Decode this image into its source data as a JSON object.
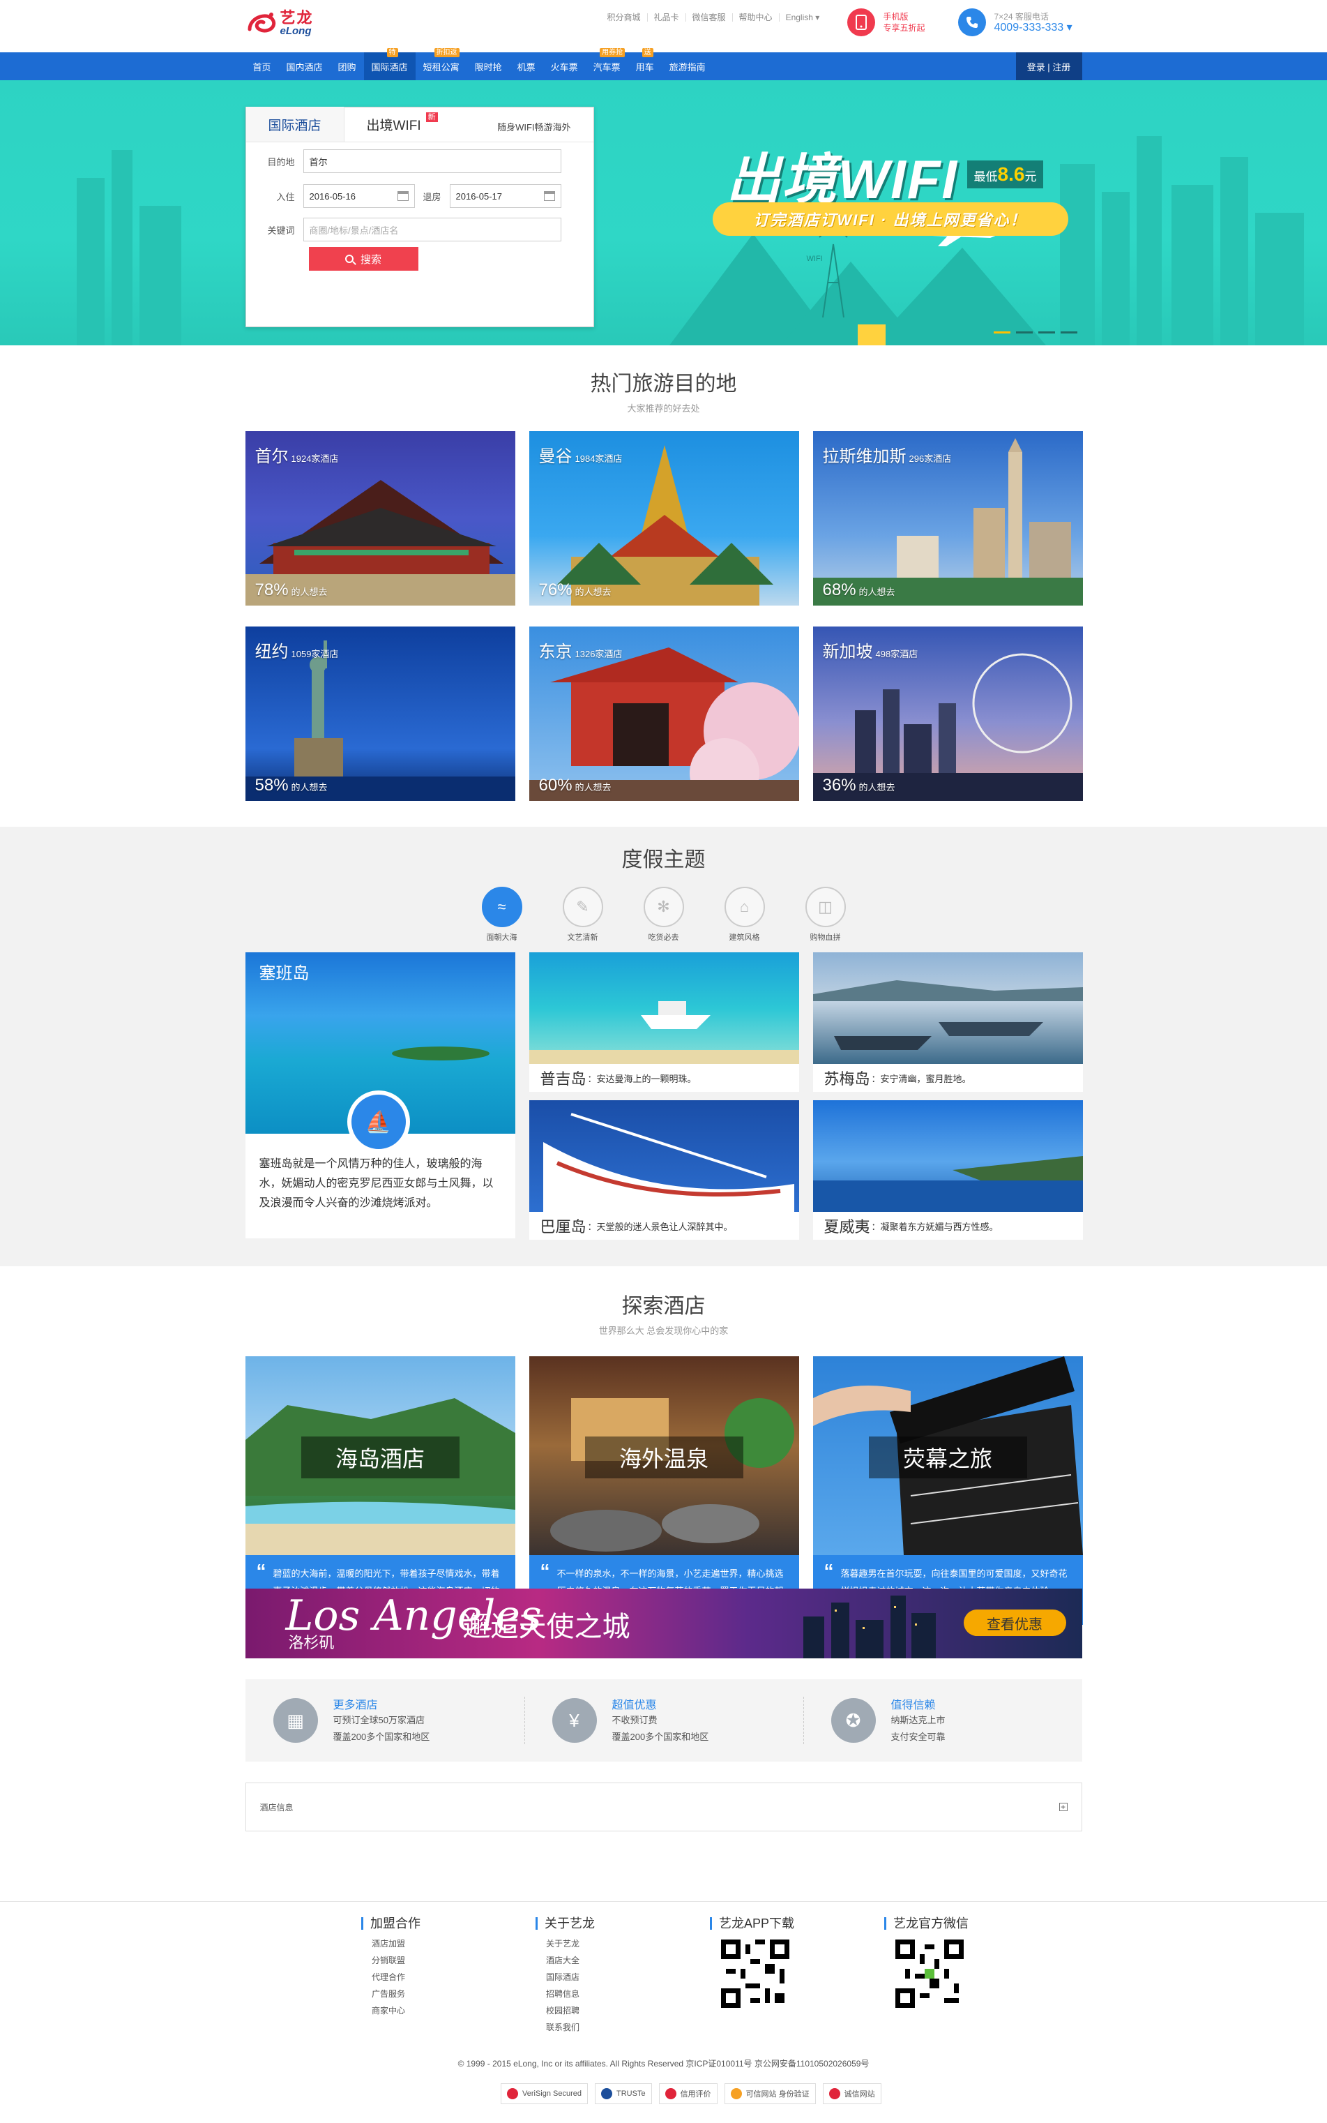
{
  "header": {
    "logo_cn": "艺龙",
    "logo_en": "eLong",
    "links": [
      "积分商城",
      "礼品卡",
      "微信客服",
      "帮助中心",
      "English ▾"
    ],
    "mobile": {
      "line1": "手机版",
      "line2": "专享五折起"
    },
    "hotline": {
      "line1": "7×24 客服电话",
      "line2": "4009-333-333 ▾"
    }
  },
  "nav": {
    "items": [
      {
        "label": "首页",
        "tag": ""
      },
      {
        "label": "国内酒店",
        "tag": ""
      },
      {
        "label": "团购",
        "tag": ""
      },
      {
        "label": "国际酒店",
        "tag": "特"
      },
      {
        "label": "短租公寓",
        "tag": "折扣返"
      },
      {
        "label": "限时抢",
        "tag": ""
      },
      {
        "label": "机票",
        "tag": ""
      },
      {
        "label": "火车票",
        "tag": ""
      },
      {
        "label": "汽车票",
        "tag": "用券抢"
      },
      {
        "label": "用车",
        "tag": "送"
      },
      {
        "label": "旅游指南",
        "tag": ""
      }
    ],
    "login": "登录 | 注册"
  },
  "search": {
    "tab_hotel": "国际酒店",
    "tab_wifi": "出境WIFI",
    "new_tag": "新",
    "slogan": "随身WIFI畅游海外",
    "dest_label": "目的地",
    "dest_value": "首尔",
    "checkin_label": "入住",
    "checkin_value": "2016-05-16",
    "checkout_label": "退房",
    "checkout_value": "2016-05-17",
    "keyword_label": "关键词",
    "keyword_placeholder": "商圈/地标/景点/酒店名",
    "button": "搜索"
  },
  "promo": {
    "title": "出境WIFI",
    "price_prefix": "最低",
    "price": "8.6",
    "price_suffix": "元",
    "subtitle": "订完酒店订WIFI · 出境上网更省心！",
    "wifi_label": "WIFI"
  },
  "destinations": {
    "title": "热门旅游目的地",
    "subtitle": "大家推荐的好去处",
    "items": [
      {
        "city": "首尔",
        "hotels": "1924家酒店",
        "pct": "78%",
        "pct_label": "的人想去"
      },
      {
        "city": "曼谷",
        "hotels": "1984家酒店",
        "pct": "76%",
        "pct_label": "的人想去"
      },
      {
        "city": "拉斯维加斯",
        "hotels": "296家酒店",
        "pct": "68%",
        "pct_label": "的人想去"
      },
      {
        "city": "纽约",
        "hotels": "1059家酒店",
        "pct": "58%",
        "pct_label": "的人想去"
      },
      {
        "city": "东京",
        "hotels": "1326家酒店",
        "pct": "60%",
        "pct_label": "的人想去"
      },
      {
        "city": "新加坡",
        "hotels": "498家酒店",
        "pct": "36%",
        "pct_label": "的人想去"
      }
    ]
  },
  "holiday": {
    "title": "度假主题",
    "themes": [
      "面朝大海",
      "文艺清新",
      "吃货必去",
      "建筑风格",
      "购物血拼"
    ],
    "big": {
      "name": "塞班岛",
      "desc": "塞班岛就是一个风情万种的佳人，玻璃般的海水，妩媚动人的密克罗尼西亚女郎与土风舞，以及浪漫而令人兴奋的沙滩烧烤派对。"
    },
    "small": [
      {
        "name": "普吉岛",
        "desc": "：安达曼海上的一颗明珠。"
      },
      {
        "name": "苏梅岛",
        "desc": "：安宁清幽，蜜月胜地。"
      },
      {
        "name": "巴厘岛",
        "desc": "：天堂般的迷人景色让人深醉其中。"
      },
      {
        "name": "夏威夷",
        "desc": "：凝聚着东方妩媚与西方性感。"
      }
    ]
  },
  "explore": {
    "title": "探索酒店",
    "subtitle": "世界那么大 总会发现你心中的家",
    "cards": [
      {
        "label": "海岛酒店",
        "text": "碧蓝的大海前，温暖的阳光下，带着孩子尽情戏水，带着妻子沙滩漫步，带着父母悠然放松，这些海岛酒店一切的美好。"
      },
      {
        "label": "海外温泉",
        "text": "不一样的泉水，不一样的海景，小艺走遍世界，精心挑选历史悠久的温泉，在这万物复苏的季节，羁于你无尽的朝气。"
      },
      {
        "label": "荧幕之旅",
        "text": "落暮趣男在首尔玩耍，向往泰国里的可爱国度，又好奇花样姐姐走过的城市，这一次，让小艺带你亲自去体验。"
      }
    ],
    "banner": {
      "script": "Los Angeles",
      "script_cn": "洛杉矶",
      "title": "邂逅天使之城",
      "button": "查看优惠"
    },
    "features": [
      {
        "title": "更多酒店",
        "line1": "可预订全球50万家酒店",
        "line2": "覆盖200多个国家和地区"
      },
      {
        "title": "超值优惠",
        "line1": "不收预订费",
        "line2": "覆盖200多个国家和地区"
      },
      {
        "title": "值得信赖",
        "line1": "纳斯达克上市",
        "line2": "支付安全可靠"
      }
    ],
    "hotel_info": "酒店信息",
    "hotel_info_toggle": "+"
  },
  "footer": {
    "cols": [
      {
        "title": "加盟合作",
        "items": [
          "酒店加盟",
          "分销联盟",
          "代理合作",
          "广告服务",
          "商家中心"
        ]
      },
      {
        "title": "关于艺龙",
        "items": [
          "关于艺龙",
          "酒店大全",
          "国际酒店",
          "招聘信息",
          "校园招聘",
          "联系我们"
        ]
      },
      {
        "title": "艺龙APP下载",
        "items": []
      },
      {
        "title": "艺龙官方微信",
        "items": []
      }
    ],
    "copyright": "© 1999 - 2015 eLong, Inc or its affiliates. All Rights Reserved 京ICP证010011号 京公网安备11010502026059号",
    "badges": [
      "VeriSign Secured",
      "TRUSTe",
      "信用评价",
      "可信网站 身份验证",
      "诚信网站"
    ]
  },
  "colors": {
    "brand_blue": "#1d6cd3",
    "accent_red": "#f0414e",
    "banner_teal": "#2dd3c3",
    "link_blue": "#2b87e8"
  }
}
